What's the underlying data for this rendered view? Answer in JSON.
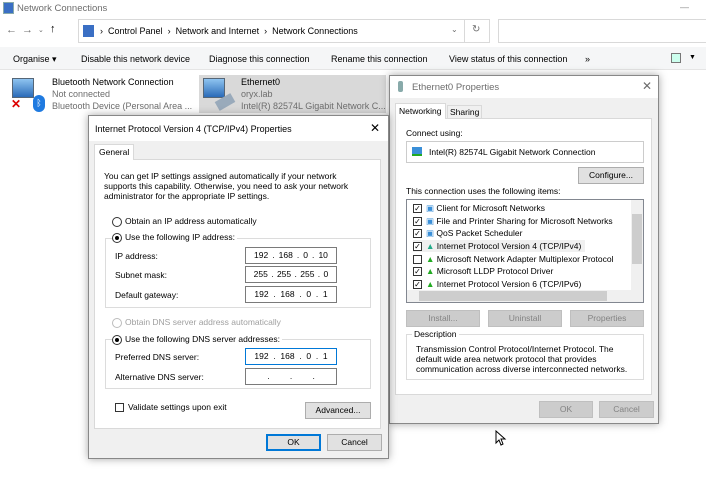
{
  "window": {
    "title": "Network Connections",
    "minimize": "—"
  },
  "address": {
    "crumbs": [
      "Control Panel",
      "Network and Internet",
      "Network Connections"
    ],
    "sep": "›"
  },
  "toolbar": {
    "organise": "Organise ▾",
    "items": [
      "Disable this network device",
      "Diagnose this connection",
      "Rename this connection",
      "View status of this connection"
    ],
    "more": "»"
  },
  "connections": [
    {
      "name": "Bluetooth Network Connection",
      "status": "Not connected",
      "device": "Bluetooth Device (Personal Area ..."
    },
    {
      "name": "Ethernet0",
      "status": "oryx.lab",
      "device": "Intel(R) 82574L Gigabit Network C..."
    }
  ],
  "eth_props": {
    "title": "Ethernet0 Properties",
    "tabs": [
      "Networking",
      "Sharing"
    ],
    "connect_using": "Connect using:",
    "adapter": "Intel(R) 82574L Gigabit Network Connection",
    "configure": "Configure...",
    "items_label": "This connection uses the following items:",
    "items": [
      {
        "label": "Client for Microsoft Networks",
        "checked": true
      },
      {
        "label": "File and Printer Sharing for Microsoft Networks",
        "checked": true
      },
      {
        "label": "QoS Packet Scheduler",
        "checked": true
      },
      {
        "label": "Internet Protocol Version 4 (TCP/IPv4)",
        "checked": true
      },
      {
        "label": "Microsoft Network Adapter Multiplexor Protocol",
        "checked": false
      },
      {
        "label": "Microsoft LLDP Protocol Driver",
        "checked": true
      },
      {
        "label": "Internet Protocol Version 6 (TCP/IPv6)",
        "checked": true
      }
    ],
    "install": "Install...",
    "uninstall": "Uninstall",
    "properties": "Properties",
    "description_label": "Description",
    "description": "Transmission Control Protocol/Internet Protocol. The default wide area network protocol that provides communication across diverse interconnected networks.",
    "ok": "OK",
    "cancel": "Cancel"
  },
  "ipv4": {
    "title": "Internet Protocol Version 4 (TCP/IPv4) Properties",
    "tab": "General",
    "intro": "You can get IP settings assigned automatically if your network supports this capability. Otherwise, you need to ask your network administrator for the appropriate IP settings.",
    "obtain_ip": "Obtain an IP address automatically",
    "use_ip": "Use the following IP address:",
    "ip_label": "IP address:",
    "ip": [
      "192",
      "168",
      "0",
      "10"
    ],
    "mask_label": "Subnet mask:",
    "mask": [
      "255",
      "255",
      "255",
      "0"
    ],
    "gw_label": "Default gateway:",
    "gw": [
      "192",
      "168",
      "0",
      "1"
    ],
    "obtain_dns": "Obtain DNS server address automatically",
    "use_dns": "Use the following DNS server addresses:",
    "pdns_label": "Preferred DNS server:",
    "pdns": [
      "192",
      "168",
      "0",
      "1"
    ],
    "adns_label": "Alternative DNS server:",
    "adns": [
      "",
      "",
      "",
      ""
    ],
    "validate": "Validate settings upon exit",
    "advanced": "Advanced...",
    "ok": "OK",
    "cancel": "Cancel"
  }
}
